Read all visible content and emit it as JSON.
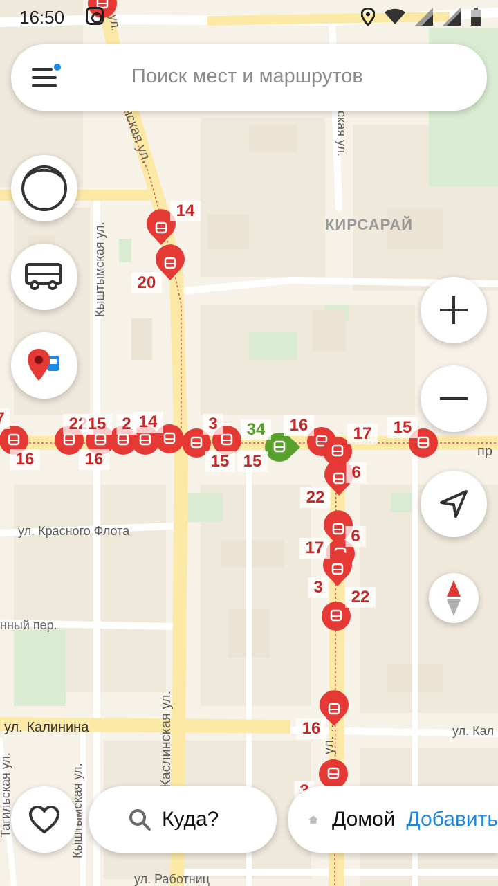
{
  "status_bar": {
    "time": "16:50",
    "icons": [
      "instagram-icon",
      "location-icon",
      "wifi-icon",
      "signal-icon",
      "signal-icon",
      "battery-icon"
    ]
  },
  "search": {
    "placeholder": "Поиск мест и маршрутов",
    "menu_icon": "menu-icon",
    "notification_dot_color": "#1e88e5"
  },
  "left_controls": [
    {
      "name": "profile-button",
      "icon": "profile-circle-icon"
    },
    {
      "name": "transport-button",
      "icon": "bus-icon"
    },
    {
      "name": "transport-layer-button",
      "icon": "map-pin-bus-icon"
    }
  ],
  "right_controls": [
    {
      "name": "zoom-in-button",
      "icon": "plus-icon"
    },
    {
      "name": "zoom-out-button",
      "icon": "minus-icon"
    },
    {
      "name": "my-location-button",
      "icon": "navigation-arrow-icon"
    },
    {
      "name": "compass-button",
      "icon": "compass-icon"
    }
  ],
  "map": {
    "streets": [
      {
        "id": "kyshtymskaya-top",
        "label": "Кыштымская ул."
      },
      {
        "id": "krasnogo-flota",
        "label": "ул. Красного Флота"
      },
      {
        "id": "lane",
        "label": "нный пер."
      },
      {
        "id": "kalinina",
        "label": "ул. Калинина"
      },
      {
        "id": "kalinina-right",
        "label": "ул. Кал"
      },
      {
        "id": "kaslinskaya-bottom",
        "label": "Каслинская ул."
      },
      {
        "id": "kaslinskaya-top",
        "label": "нская ул."
      },
      {
        "id": "kyshtymskaya-bottom",
        "label": "Кыштымская ул."
      },
      {
        "id": "tagilskaya",
        "label": "Тагильская ул."
      },
      {
        "id": "rabotnits",
        "label": "ул. Работниц"
      },
      {
        "id": "bolnichnaya-top",
        "label": "ская ул."
      },
      {
        "id": "ul-ova",
        "label": "ул. ...ова"
      },
      {
        "id": "pr",
        "label": "пр"
      },
      {
        "id": "ul-top",
        "label": "ул."
      }
    ],
    "districts": [
      "КИРСАРАЙ"
    ],
    "transit_color": "#e53935",
    "active_stop_color": "#5aa02c",
    "route_labels": [
      "14",
      "20",
      "22",
      "15",
      "14",
      "3",
      "34",
      "16",
      "17",
      "15",
      "16",
      "16",
      "15",
      "15",
      "6",
      "22",
      "6",
      "17",
      "3",
      "22",
      "16",
      "3",
      "7",
      "2"
    ]
  },
  "bottom_bar": {
    "favorites_icon": "heart-icon",
    "where_label": "Куда?",
    "search_icon": "search-icon",
    "home_icon": "home-icon",
    "home_label": "Домой",
    "add_label": "Добавить"
  }
}
